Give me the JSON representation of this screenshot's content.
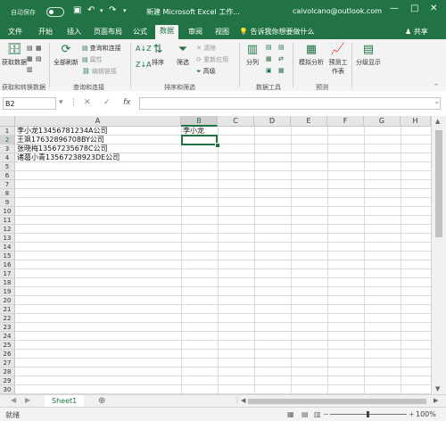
{
  "titlebar": {
    "autosave": "自动保存",
    "title": "新建 Microsoft Excel 工作...",
    "account": "caivolcano@outlook.com",
    "controls": [
      "—",
      "□",
      "✕"
    ]
  },
  "tabs": [
    "文件",
    "开始",
    "插入",
    "页面布局",
    "公式",
    "数据",
    "审阅",
    "视图"
  ],
  "active_tab": "数据",
  "tellme": "告诉我你想要做什么",
  "share": "共享",
  "ribbon": {
    "get_data": "获取数据",
    "refresh_all": "全部刷新",
    "queries_connections": "查询和连接",
    "properties": "属性",
    "edit_links": "编辑链接",
    "sort": "排序",
    "filter": "筛选",
    "clear": "清除",
    "reapply": "重新应用",
    "advanced": "高级",
    "text_to_columns": "分列",
    "what_if": "模拟分析",
    "forecast_sheet": "预测工作表",
    "outline": "分级显示",
    "groups": {
      "get_transform": "获取和转换数据",
      "queries": "查询和连接",
      "sort_filter": "排序和筛选",
      "data_tools": "数据工具",
      "forecast": "预测"
    }
  },
  "formula_bar": {
    "name_box": "B2",
    "cancel": "✕",
    "enter": "✓",
    "fx": "fx",
    "value": ""
  },
  "columns": [
    "A",
    "B",
    "C",
    "D",
    "E",
    "F",
    "G",
    "H"
  ],
  "rows": [
    "1",
    "2",
    "3",
    "4",
    "5",
    "6",
    "7",
    "8",
    "9",
    "10",
    "11",
    "12",
    "13",
    "14",
    "15",
    "16",
    "17",
    "18",
    "19",
    "20",
    "21",
    "22",
    "23",
    "24",
    "25",
    "26",
    "27",
    "28",
    "29",
    "30"
  ],
  "cells": {
    "A1": "李小龙13456781234A公司",
    "A2": "王飒17632896708BY公司",
    "A3": "张晓梅13567235678C公司",
    "A4": "诸葛小青13567238923DE公司",
    "B1": "李小龙"
  },
  "sheet_tab": "Sheet1",
  "add_sheet": "⊕",
  "status": "就绪",
  "zoom": "100%",
  "colors": {
    "excel_green": "#217346"
  }
}
